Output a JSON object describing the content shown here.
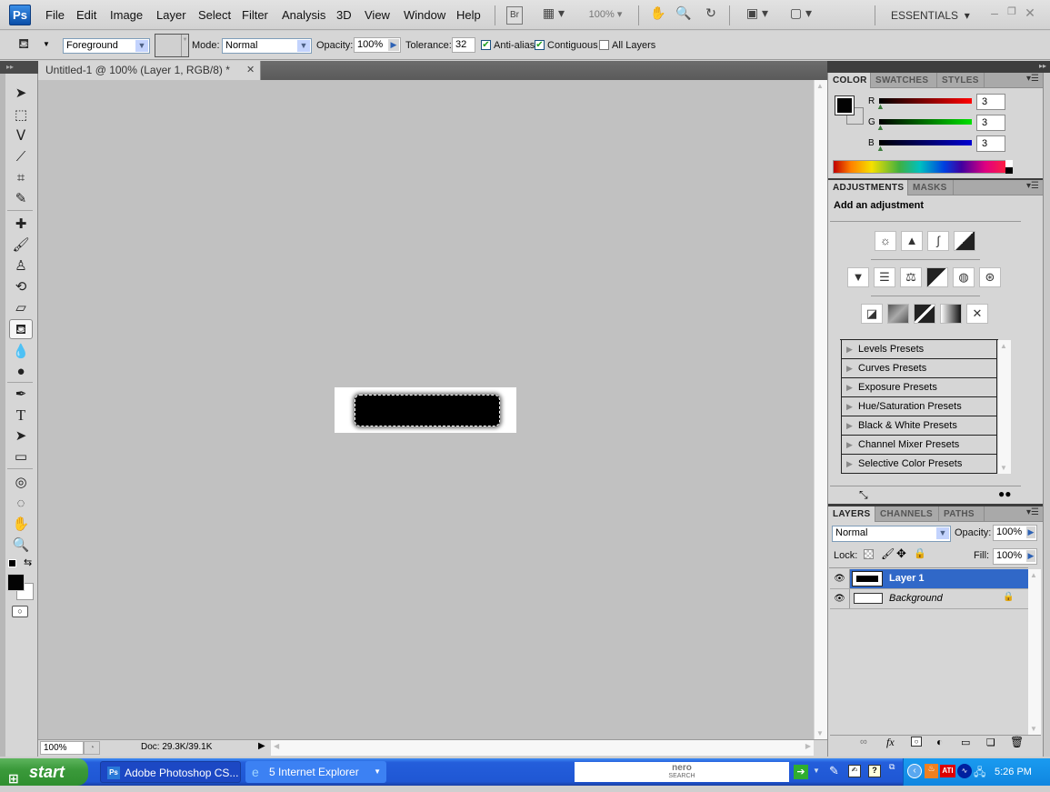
{
  "app": {
    "logo": "Ps",
    "menus": [
      "File",
      "Edit",
      "Image",
      "Layer",
      "Select",
      "Filter",
      "Analysis",
      "3D",
      "View",
      "Window",
      "Help"
    ],
    "bridge_label": "Br",
    "zoom_value": "100%",
    "workspace": "ESSENTIALS"
  },
  "options": {
    "fill_source": "Foreground",
    "mode_label": "Mode:",
    "mode_value": "Normal",
    "opacity_label": "Opacity:",
    "opacity_value": "100%",
    "tolerance_label": "Tolerance:",
    "tolerance_value": "32",
    "anti_alias_label": "Anti-alias",
    "anti_alias_checked": true,
    "contiguous_label": "Contiguous",
    "contiguous_checked": true,
    "all_layers_label": "All Layers",
    "all_layers_checked": false
  },
  "document": {
    "tab_title": "Untitled-1 @ 100% (Layer 1, RGB/8) *",
    "zoom": "100%",
    "doc_info": "Doc: 29.3K/39.1K"
  },
  "color_panel": {
    "tabs": [
      "COLOR",
      "SWATCHES",
      "STYLES"
    ],
    "channels": [
      {
        "label": "R",
        "value": "3",
        "color": "#ff0000"
      },
      {
        "label": "G",
        "value": "3",
        "color": "#00e000"
      },
      {
        "label": "B",
        "value": "3",
        "color": "#0000d0"
      }
    ],
    "foreground": "#030303",
    "background": "#d6d6d6"
  },
  "adjustments_panel": {
    "tabs": [
      "ADJUSTMENTS",
      "MASKS"
    ],
    "heading": "Add an adjustment",
    "presets": [
      "Levels Presets",
      "Curves Presets",
      "Exposure Presets",
      "Hue/Saturation Presets",
      "Black & White Presets",
      "Channel Mixer Presets",
      "Selective Color Presets"
    ]
  },
  "layers_panel": {
    "tabs": [
      "LAYERS",
      "CHANNELS",
      "PATHS"
    ],
    "blend_mode": "Normal",
    "opacity_label": "Opacity:",
    "opacity_value": "100%",
    "lock_label": "Lock:",
    "fill_label": "Fill:",
    "fill_value": "100%",
    "layers": [
      {
        "name": "Layer 1",
        "selected": true,
        "visible": true
      },
      {
        "name": "Background",
        "selected": false,
        "visible": true,
        "locked": true
      }
    ]
  },
  "taskbar": {
    "start_label": "start",
    "buttons": [
      "Adobe Photoshop CS...",
      "5 Internet Explorer"
    ],
    "search_brand": "nero",
    "search_sub": "SEARCH",
    "clock": "5:26 PM"
  }
}
